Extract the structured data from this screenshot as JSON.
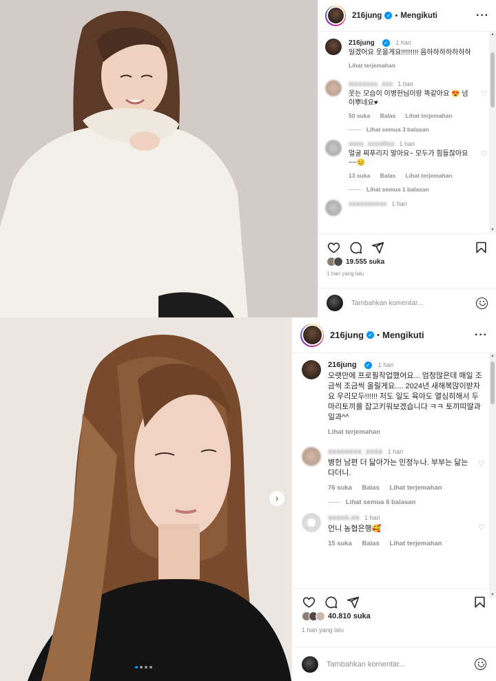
{
  "post1": {
    "username": "216jung",
    "follow_label": "Mengikuti",
    "caption": {
      "time": "1 hari",
      "text": "일겠어요 웃을게요!!!!!!!!! 음하하하하하하하",
      "see_translation": "Lihat terjemahan"
    },
    "comments": [
      {
        "user": "mxxxxxx_xxx",
        "time": "1 hari",
        "text": "웃는 모습이 이병헌님이랑 똑같아요 😍 넘 이뿌네요♥",
        "likes": "50 suka",
        "reply": "Balas",
        "translate": "Lihat terjemahan",
        "replies": "Lihat semua 3 balasan"
      },
      {
        "user": "xxxx_xxxx0xx",
        "time": "1 hari",
        "text": "얼굴 찌푸리지 말아요~ 모두가 힘들잖아요~~😊",
        "likes": "13 suka",
        "reply": "Balas",
        "translate": "Lihat terjemahan",
        "replies": "Lihat semua 1 balasan"
      },
      {
        "user": "xxxxxxxxxx",
        "time": "1 hari"
      }
    ],
    "likes_count": "19.555 suka",
    "time_ago": "1 hari yang lalu",
    "comment_placeholder": "Tambahkan komentar..."
  },
  "post2": {
    "username": "216jung",
    "follow_label": "Mengikuti",
    "caption": {
      "time": "1 hari",
      "text": "오랫만에 프로필작업했어요... 엄청많은데 매일 조금씩 조금씩 올릴게요.... 2024년 새해복많이받자요 우리모두!!!!!! 저도 일도 육아도 열심히해서 두마리토끼를 잡고키워보겠습니다 ㅋㅋ 토끼띠딸과 일과^^",
      "see_translation": "Lihat terjemahan"
    },
    "comments": [
      {
        "user": "xxxxxxxx_xxxx",
        "time": "1 hari",
        "text": "병헌 남편 더 닮아가는 민정누나. 부부는 닮는다더니.",
        "likes": "76 suka",
        "reply": "Balas",
        "translate": "Lihat terjemahan",
        "replies": "Lihat semua 6 balasan"
      },
      {
        "user": "xxxxx.xx",
        "time": "1 hari",
        "text": "언니 농협은행🥰",
        "likes": "15 suka",
        "reply": "Balas",
        "translate": "Lihat terjemahan"
      }
    ],
    "likes_count": "40.810 suka",
    "time_ago": "1 hari yang lalu",
    "comment_placeholder": "Tambahkan komentar..."
  },
  "icons": {
    "verified": "✓",
    "more": "···",
    "next": "›"
  },
  "colors": {
    "accent": "#0095f6",
    "muted": "#8e8e8e",
    "text": "#262626"
  }
}
